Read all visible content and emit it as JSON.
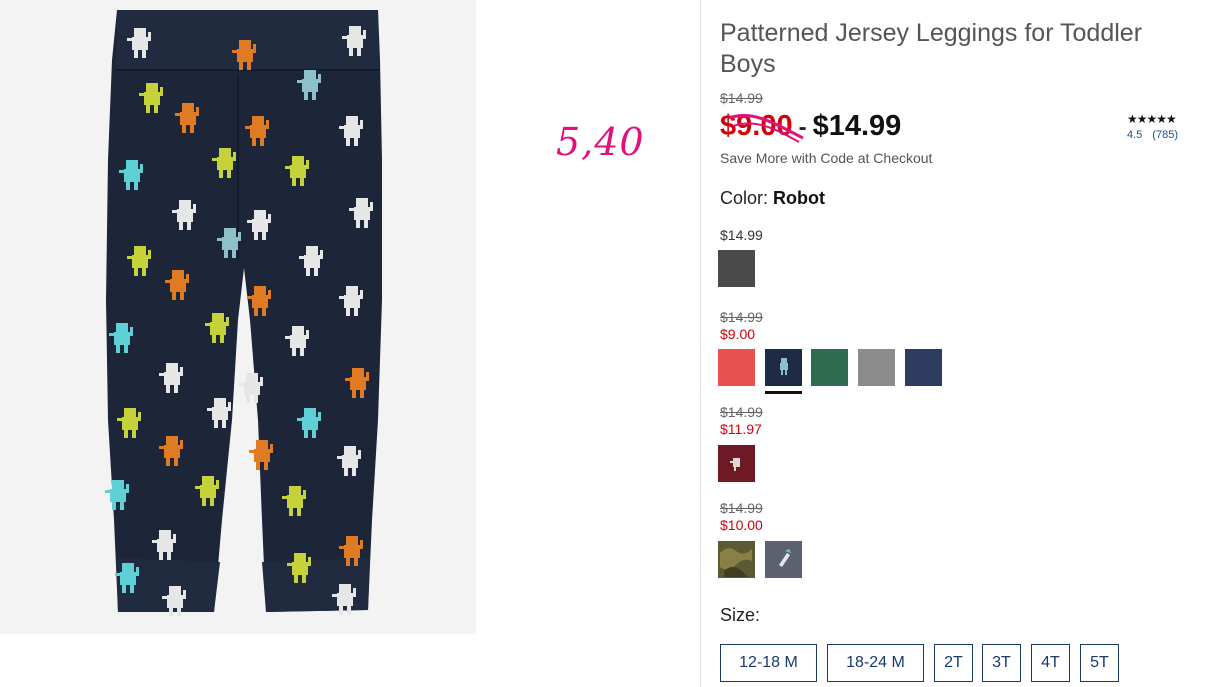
{
  "annotation": "5,40",
  "product": {
    "title": "Patterned Jersey Leggings for Toddler Boys",
    "original_price": "$14.99",
    "sale_price": "$9.00",
    "price_separator": "-",
    "regular_price": "$14.99",
    "promo_text": "Save More with Code at Checkout",
    "rating": {
      "stars": "★★★★★",
      "value": "4.5",
      "count": "(785)"
    },
    "color_label": "Color:",
    "color_value": "Robot"
  },
  "color_groups": [
    {
      "price": "$14.99"
    },
    {
      "original_price": "$14.99",
      "sale_price": "$9.00"
    },
    {
      "original_price": "$14.99",
      "sale_price": "$11.97"
    },
    {
      "original_price": "$14.99",
      "sale_price": "$10.00"
    }
  ],
  "swatches": [
    {
      "name": "dark-heather-gray",
      "color": "#4a4a4a"
    },
    {
      "name": "red-heather",
      "color": "#e8534f"
    },
    {
      "name": "navy-robot",
      "color": "#1f2a44",
      "selected": true
    },
    {
      "name": "green-heather",
      "color": "#2f6b4f"
    },
    {
      "name": "gray-heather",
      "color": "#8c8c8c"
    },
    {
      "name": "navy-heather",
      "color": "#2c3b5e"
    },
    {
      "name": "burgundy-print",
      "color": "#6e1a24"
    },
    {
      "name": "camo-print",
      "color": "#5c5a34"
    },
    {
      "name": "gray-print",
      "color": "#5c6170"
    }
  ],
  "size_label": "Size:",
  "sizes": [
    "12-18 M",
    "18-24 M",
    "2T",
    "3T",
    "4T",
    "5T"
  ],
  "colors": {
    "sale": "#d2000b",
    "annotation": "#e0117a",
    "size_border": "#1a3a6b",
    "pants": "#1c2638"
  }
}
